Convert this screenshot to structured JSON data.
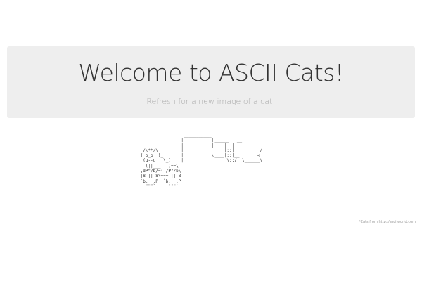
{
  "header": {
    "title": "Welcome to ASCII Cats!",
    "subtitle": "Refresh for a new image of a cat!"
  },
  "cat": {
    "art": "                  ___________\n                 |           |______   __\n                 |___________|    |__|  |________\n  /\\**/\\         |                |::|  |       /\n ( o_o  )_       |           \\____|::|__|      <\n  (u--u   \\_)    |                 \\::/  \\______\\\n   (||___   )==\\\n ,dP\"/b/=( /P\"/b\\\n |8 || 8\\=== || 8\n `b,  ,P  `b,  ,P\n   \"\"\"`     \"\"\"`"
  },
  "footer": {
    "credit": "*Cats from http://asciiworld.com"
  }
}
